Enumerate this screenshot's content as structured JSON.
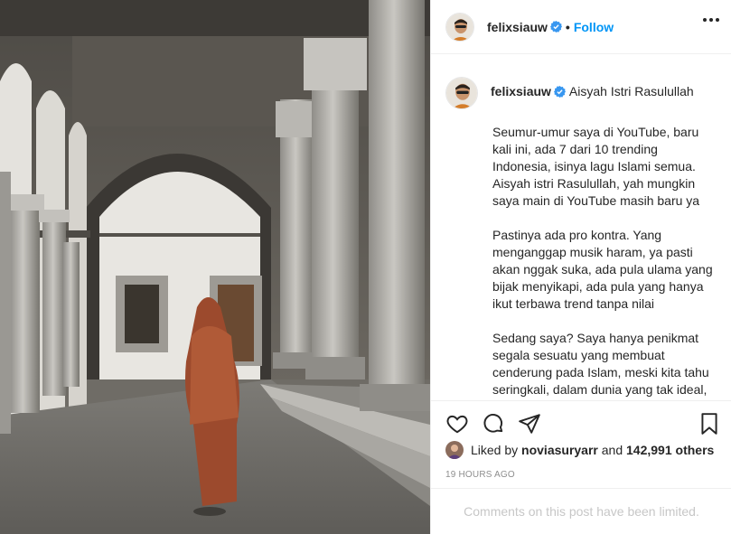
{
  "post": {
    "image_alt": "Woman in hijab walking through mosque colonnade"
  },
  "header": {
    "username": "felixsiauw",
    "separator": "•",
    "follow_label": "Follow"
  },
  "caption": {
    "username": "felixsiauw",
    "title": "Aisyah Istri Rasulullah",
    "body": "Seumur-umur saya di YouTube, baru kali ini, ada 7 dari 10 trending Indonesia, isinya lagu Islami semua. Aisyah istri Rasulullah, yah mungkin saya main di YouTube masih baru ya\n\nPastinya ada pro kontra. Yang menganggap musik haram, ya pasti akan nggak suka, ada pula ulama yang bijak menyikapi, ada pula yang hanya ikut terbawa trend tanpa nilai\n\nSedang saya? Saya hanya penikmat segala sesuatu yang membuat cenderung pada Islam, meski kita tahu seringkali, dalam dunia yang tak ideal, sulit menemukan kesempurnaan"
  },
  "likes": {
    "prefix": "Liked by",
    "user": "noviasuryarr",
    "joiner": "and",
    "count": "142,991 others"
  },
  "timestamp": "19 HOURS AGO",
  "comments_notice": "Comments on this post have been limited.",
  "colors": {
    "accent": "#0095f6",
    "verified": "#3897f0",
    "muted": "#8e8e8e"
  },
  "icons": [
    "verified-badge-icon",
    "more-options-icon",
    "heart-icon",
    "comment-icon",
    "share-icon",
    "bookmark-icon"
  ]
}
